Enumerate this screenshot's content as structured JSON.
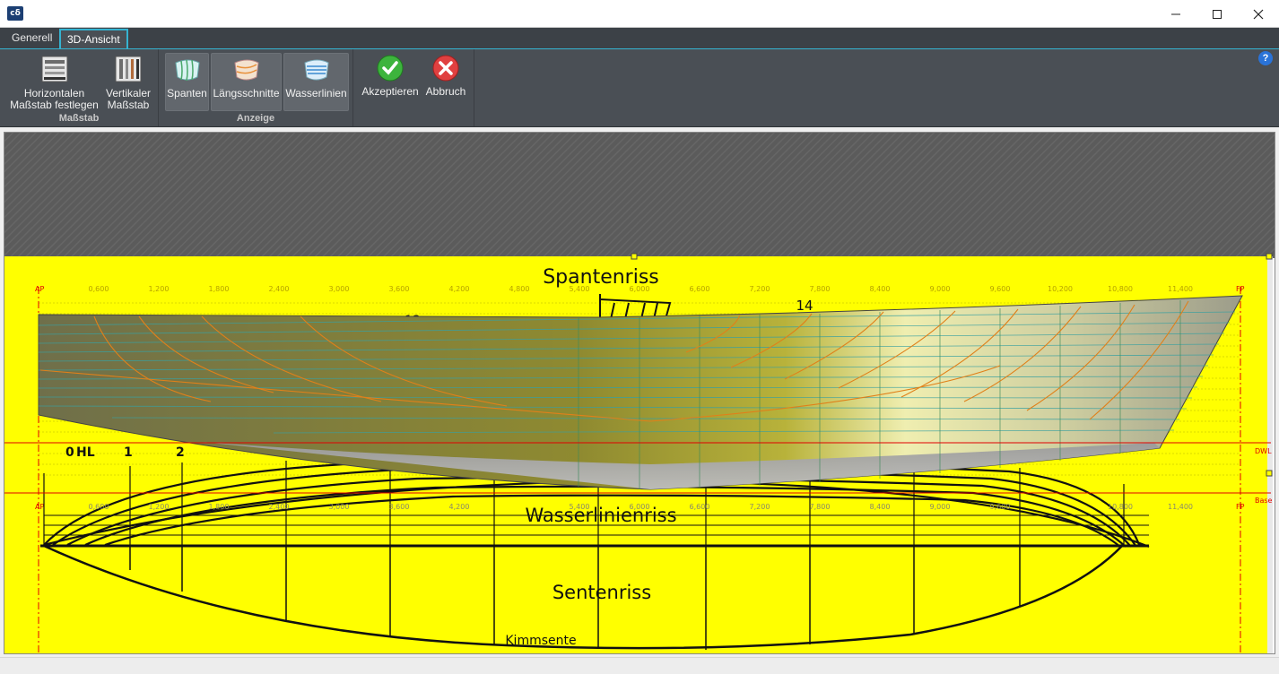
{
  "window": {
    "app_icon_text": "cδ",
    "minimize": "—",
    "maximize": "☐",
    "close": "✕"
  },
  "tabs": [
    {
      "label": "Generell"
    },
    {
      "label": "3D-Ansicht"
    }
  ],
  "ribbon": {
    "groups": {
      "massstab": {
        "label": "Maßstab",
        "horizontal_line1": "Horizontalen",
        "horizontal_line2": "Maßstab festlegen",
        "vertical_line1": "Vertikaler",
        "vertical_line2": "Maßstab"
      },
      "anzeige": {
        "label": "Anzeige",
        "spanten": "Spanten",
        "laengsschnitte": "Längsschnitte",
        "wasserlinien": "Wasserlinien"
      },
      "actions": {
        "accept": "Akzeptieren",
        "cancel": "Abbruch"
      }
    },
    "help": "?"
  },
  "drawing": {
    "titles": {
      "spantenriss": "Spantenriss",
      "wasserlinienriss": "Wasserlinienriss",
      "sentenriss": "Sentenriss",
      "kimmsente": "Kimmsente"
    },
    "ruler_ticks": [
      "0,600",
      "1,200",
      "1,800",
      "2,400",
      "3,000",
      "3,600",
      "4,200",
      "4,800",
      "5,400",
      "6,000",
      "6,600",
      "7,200",
      "7,800",
      "8,400",
      "9,000",
      "9,600",
      "10,200",
      "10,800",
      "11,400"
    ],
    "ap_label": "AP",
    "fp_label": "FP",
    "dwl_label": "DWL",
    "base_label": "Base",
    "station_labels": [
      "0",
      "HL",
      "1",
      "2"
    ],
    "label_13": "13",
    "label_14": "14"
  },
  "colors": {
    "accent": "#35b3d1",
    "ribbon_bg": "#4a4f55",
    "sheet": "#ffff00",
    "ref_line": "#ff0000"
  }
}
